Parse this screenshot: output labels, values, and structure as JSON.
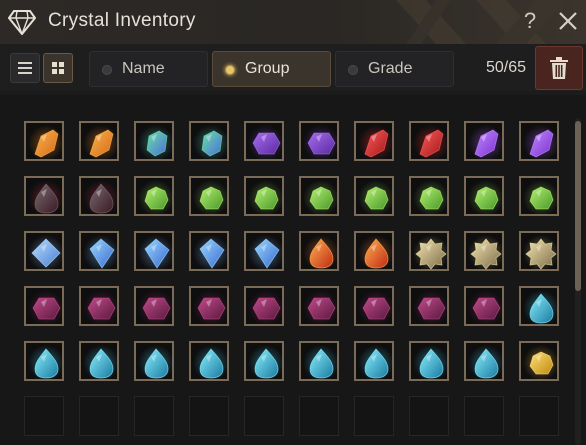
{
  "window": {
    "title": "Crystal Inventory",
    "help_label": "?"
  },
  "toolbar": {
    "sort_options": [
      {
        "label": "Name",
        "selected": false
      },
      {
        "label": "Group",
        "selected": true
      },
      {
        "label": "Grade",
        "selected": false
      }
    ],
    "count": "50/65"
  },
  "inventory": {
    "rows": [
      [
        "orange-crystal",
        "orange-crystal",
        "green-blue-crystal",
        "green-blue-crystal",
        "purple-hex-crystal",
        "purple-hex-crystal",
        "red-shard-crystal",
        "red-shard-crystal",
        "violet-shard-crystal",
        "violet-shard-crystal"
      ],
      [
        "dark-red-teardrop-crystal",
        "dark-red-teardrop-crystal",
        "green-round-crystal",
        "green-round-crystal",
        "green-round-crystal",
        "green-round-crystal",
        "green-round-crystal",
        "green-round-crystal",
        "green-round-crystal",
        "green-round-crystal"
      ],
      [
        "blue-diamond-crystal",
        "blue-kite-crystal",
        "blue-kite-crystal",
        "blue-kite-crystal",
        "blue-kite-crystal",
        "red-flame-crystal",
        "red-flame-crystal",
        "yellow-gear-crystal",
        "yellow-gear-crystal",
        "yellow-gear-crystal"
      ],
      [
        "magenta-hex-crystal",
        "magenta-hex-crystal",
        "magenta-hex-crystal",
        "magenta-hex-crystal",
        "magenta-hex-crystal",
        "magenta-hex-crystal",
        "magenta-hex-crystal",
        "magenta-hex-crystal",
        "magenta-hex-crystal",
        "cyan-teardrop-crystal"
      ],
      [
        "cyan-teardrop-crystal",
        "cyan-teardrop-crystal",
        "cyan-teardrop-crystal",
        "cyan-teardrop-crystal",
        "cyan-teardrop-crystal",
        "cyan-teardrop-crystal",
        "cyan-teardrop-crystal",
        "cyan-teardrop-crystal",
        "cyan-teardrop-crystal",
        "gold-orb-crystal"
      ],
      [
        "empty",
        "empty",
        "empty",
        "empty",
        "empty",
        "empty",
        "empty",
        "empty",
        "empty",
        "empty"
      ]
    ]
  },
  "colors": {
    "accent_gold": "#e6c56a",
    "delete_red": "#4a2520",
    "slot_border": "#7a6a58"
  }
}
